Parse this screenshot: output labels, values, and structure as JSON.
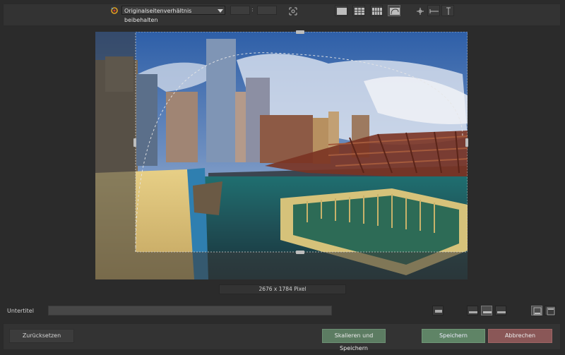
{
  "toolbar": {
    "ratio_icon": "aspect-ratio-lock-icon",
    "aspect_ratio_selected": "Originalseitenverhältnis beibehalten",
    "ratio_width_value": "",
    "ratio_height_value": "",
    "ratio_separator": ":",
    "icons": [
      "center-crop-icon",
      "grid-none-icon",
      "grid-3x3-icon",
      "grid-4x3-icon",
      "grid-golden-spiral-icon",
      "crosshair-icon",
      "horizontal-guide-icon",
      "vertical-guide-icon"
    ]
  },
  "image": {
    "size_label": "2676 x 1784  Pixel"
  },
  "subtitle": {
    "label": "Untertitel",
    "value": "",
    "option_icons": [
      "subtitle-text-box-icon",
      "align-left-icon",
      "align-center-icon",
      "align-right-icon",
      "position-bottom-icon",
      "position-top-icon"
    ]
  },
  "footer": {
    "reset_label": "Zurücksetzen",
    "scale_save_label": "Skalieren und Speichern",
    "save_label": "Speichern",
    "cancel_label": "Abbrechen"
  },
  "colors": {
    "background": "#2b2b2b",
    "panel": "#333333",
    "save_green": "#5f8466",
    "cancel_red": "#8a5757"
  }
}
